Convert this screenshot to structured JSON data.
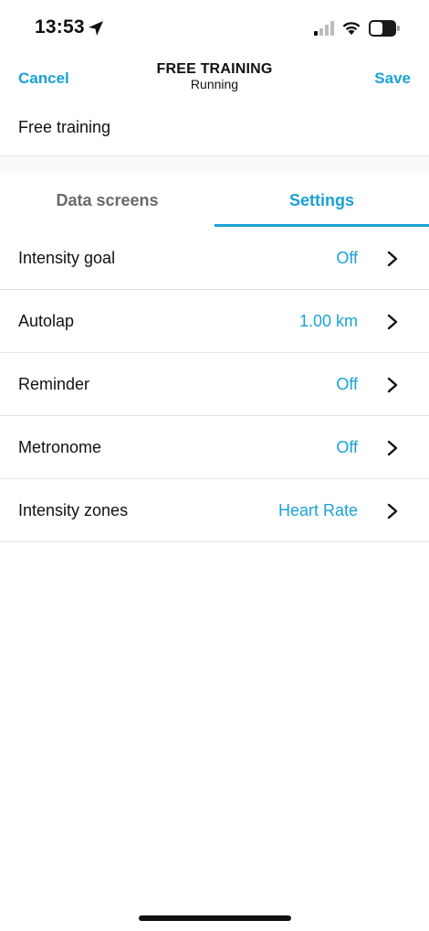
{
  "status_bar": {
    "time": "13:53",
    "battery_level": "50",
    "battery_fraction": 0.5,
    "icons": [
      "location-arrow-icon",
      "cellular-signal-icon",
      "wifi-icon",
      "battery-icon"
    ]
  },
  "nav": {
    "cancel_label": "Cancel",
    "title": "FREE TRAINING",
    "subtitle": "Running",
    "save_label": "Save"
  },
  "workout_name": "Free training",
  "tabs": [
    {
      "label": "Data screens",
      "selected": false
    },
    {
      "label": "Settings",
      "selected": true
    }
  ],
  "settings": [
    {
      "label": "Intensity goal",
      "value": "Off"
    },
    {
      "label": "Autolap",
      "value": "1.00 km"
    },
    {
      "label": "Reminder",
      "value": "Off"
    },
    {
      "label": "Metronome",
      "value": "Off"
    },
    {
      "label": "Intensity zones",
      "value": "Heart Rate"
    }
  ],
  "colors": {
    "accent": "#1aa2d6",
    "text": "#111111",
    "inactive_tab": "#6a6a6a",
    "divider": "#e3e3e3"
  }
}
